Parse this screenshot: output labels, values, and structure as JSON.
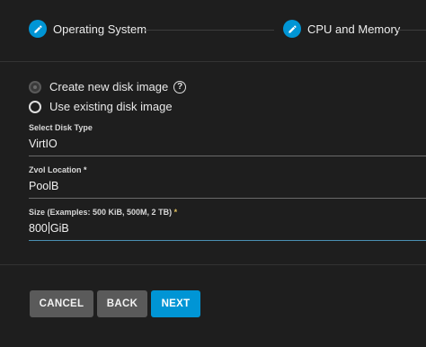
{
  "stepper": {
    "steps": [
      {
        "label": "Operating System",
        "icon": "pencil-icon"
      },
      {
        "label": "CPU and Memory",
        "icon": "pencil-icon"
      }
    ]
  },
  "disk_source": {
    "options": [
      {
        "label": "Create new disk image",
        "selected": false,
        "disabled": true
      },
      {
        "label": "Use existing disk image",
        "selected": false,
        "disabled": false
      }
    ],
    "help_symbol": "?"
  },
  "fields": {
    "disk_type": {
      "label": "Select Disk Type",
      "value": "VirtIO"
    },
    "zvol_location": {
      "label": "Zvol Location",
      "required_marker": "*",
      "value": "PoolB"
    },
    "size": {
      "label": "Size (Examples: 500 KiB, 500M, 2 TB)",
      "required_marker": "*",
      "value_before_caret": "800",
      "value_after_caret": "GiB"
    }
  },
  "buttons": {
    "cancel": "CANCEL",
    "back": "BACK",
    "next": "NEXT"
  },
  "colors": {
    "accent": "#0095d5",
    "background": "#1e1e1e",
    "button_gray": "#5a5a5a"
  }
}
